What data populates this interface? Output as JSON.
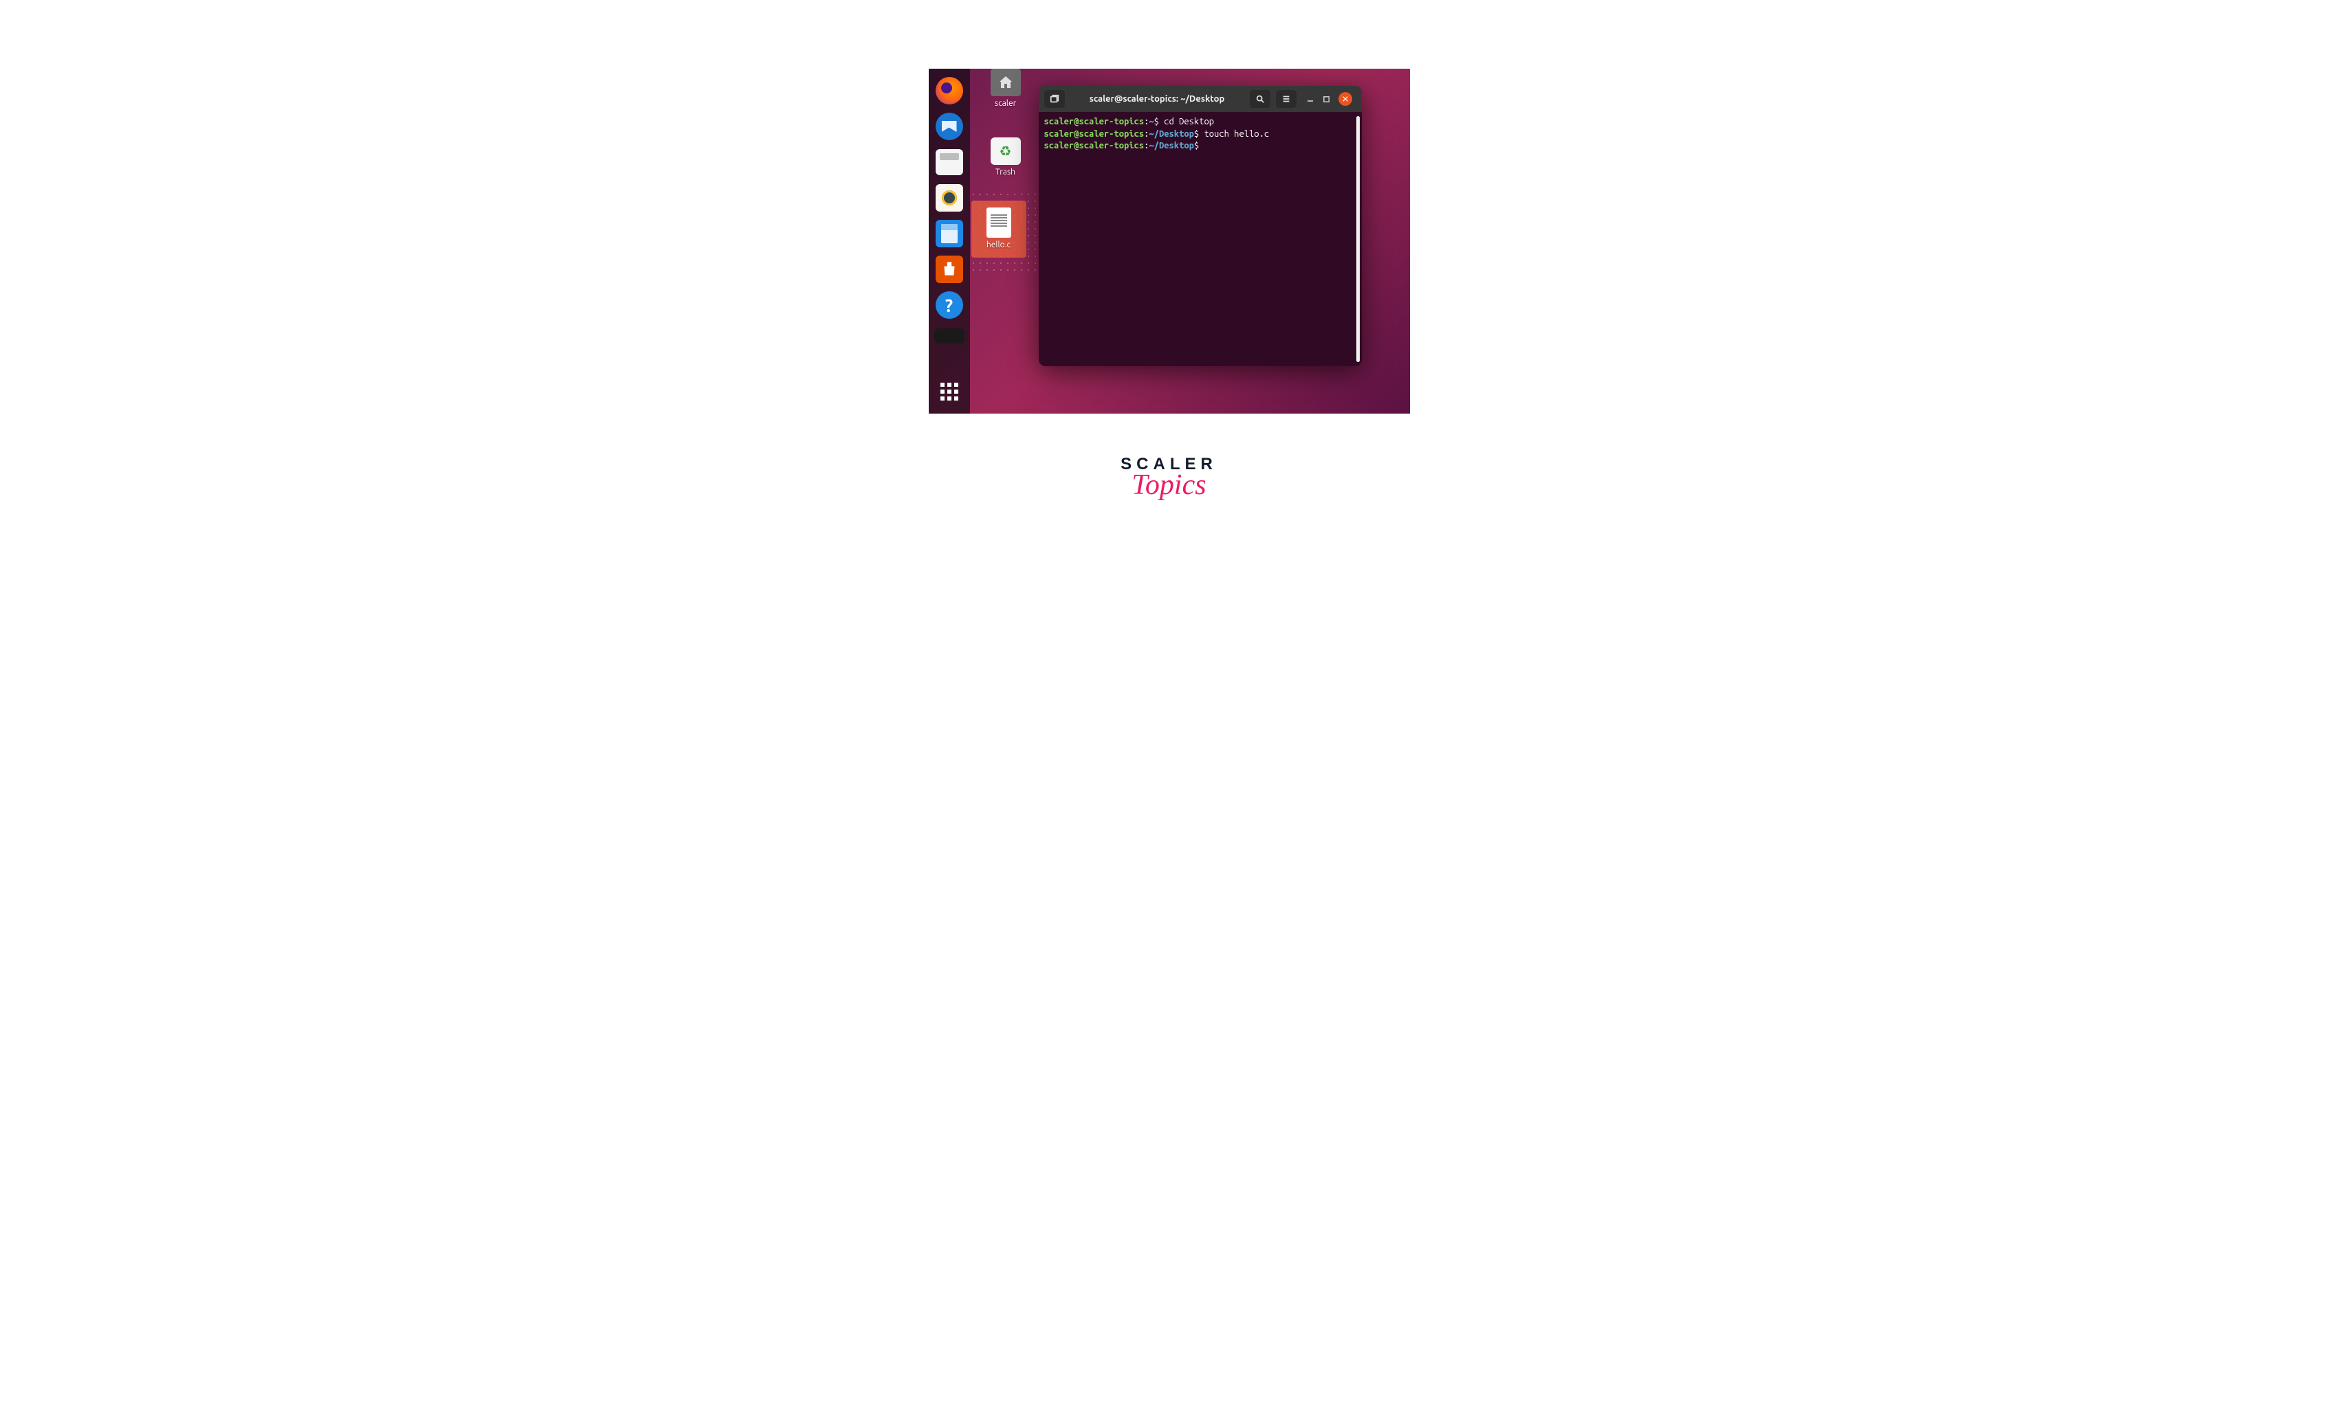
{
  "desktop": {
    "icons": [
      {
        "label": "scaler"
      },
      {
        "label": "Trash"
      },
      {
        "label": "hello.c"
      }
    ]
  },
  "terminal": {
    "title": "scaler@scaler-topics: ~/Desktop",
    "lines": [
      {
        "user": "scaler@scaler-topics",
        "path": "~",
        "cmd": "cd Desktop"
      },
      {
        "user": "scaler@scaler-topics",
        "path": "~/Desktop",
        "cmd": "touch hello.c"
      },
      {
        "user": "scaler@scaler-topics",
        "path": "~/Desktop",
        "cmd": ""
      }
    ]
  },
  "logo": {
    "line1": "SCALER",
    "line2": "Topics"
  },
  "help_glyph": "?"
}
